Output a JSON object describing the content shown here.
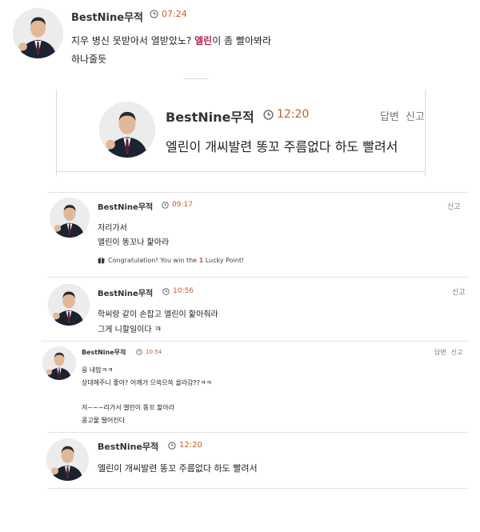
{
  "post": {
    "author": "BestNine무적",
    "time": "07:24",
    "line1_before": "지우 병신 못받아서 열받았노? ",
    "line1_highlight": "엘린",
    "line1_after": "이 좀 빨아봐라",
    "line2": "하나줄듯"
  },
  "quoted": {
    "author": "BestNine무적",
    "time": "12:20",
    "reply_label": "답변",
    "report_label": "신고",
    "body": "엘린이 개씨발련 똥꼬 주름없다 하도 빨려서"
  },
  "comments": [
    {
      "author": "BestNine무적",
      "time": "09:17",
      "report_label": "신고",
      "line1": "저리가서",
      "line2": "엘린이 똥꼬나 핥아라",
      "lucky_prefix": "Congratulation! You win the ",
      "lucky_count": "1",
      "lucky_suffix": " Lucky Point!"
    },
    {
      "author": "BestNine무적",
      "time": "10:56",
      "report_label": "신고",
      "line1": "학씨랑 같이 손잡고 엘린이 핥아줘라",
      "line2": "그게 니할일이다 ㅋ"
    },
    {
      "author": "BestNine무적",
      "time": "10:54",
      "reply_label": "답변",
      "report_label": "신고",
      "line1": "응 내맘ㅋㅋ",
      "line2": "상대해주니 좋아?  어깨가 으쓱으쓱 올라감??ㅋㅋ",
      "line3": "저~~~리가서 엘린이 똥꼬 할아라",
      "line4": "콩고물 떨어진다"
    },
    {
      "author": "BestNine무적",
      "time": "12:20",
      "line1": "엘린이 개씨발련 똥꼬 주름없다 하도 빨려서"
    }
  ],
  "colors": {
    "time": "#c0602a",
    "highlight": "#b0245a"
  },
  "icons": {
    "clock": "clock-icon",
    "gift": "gift-icon"
  }
}
